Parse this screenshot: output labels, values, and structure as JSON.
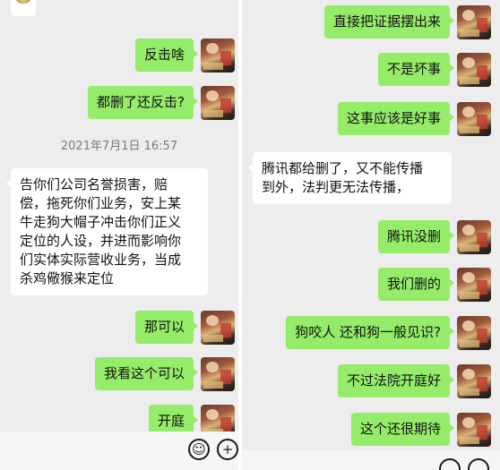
{
  "left": {
    "timestamp": "2021年7月1日 16:57",
    "messages": [
      {
        "side": "out",
        "text": "反击啥"
      },
      {
        "side": "out",
        "text": "都删了还反击?"
      },
      {
        "side": "in",
        "text": "告你们公司名誉损害，赔\n偿，拖死你们业务，安上某\n牛走狗大帽子冲击你们正义\n定位的人设，并进而影响你\n们实体实际营收业务，当成\n杀鸡儆猴来定位"
      },
      {
        "side": "out",
        "text": "那可以"
      },
      {
        "side": "out",
        "text": "我看这个可以"
      },
      {
        "side": "out",
        "text": "开庭"
      }
    ],
    "input_icons": {
      "emoji": "☺",
      "plus": "+"
    }
  },
  "right": {
    "messages": [
      {
        "side": "out",
        "text": "直接把证据摆出来"
      },
      {
        "side": "out",
        "text": "不是坏事"
      },
      {
        "side": "out",
        "text": "这事应该是好事"
      },
      {
        "side": "in",
        "text": "腾讯都给删了，又不能传播\n到外，法判更无法传播，"
      },
      {
        "side": "out",
        "text": "腾讯没删"
      },
      {
        "side": "out",
        "text": "我们删的"
      },
      {
        "side": "out",
        "text": "狗咬人 还和狗一般见识?"
      },
      {
        "side": "out",
        "text": "不过法院开庭好"
      },
      {
        "side": "out",
        "text": "这个还很期待"
      }
    ]
  },
  "colors": {
    "outgoing_bubble": "#95ec69",
    "incoming_bubble": "#ffffff",
    "chat_bg": "#ededed"
  }
}
